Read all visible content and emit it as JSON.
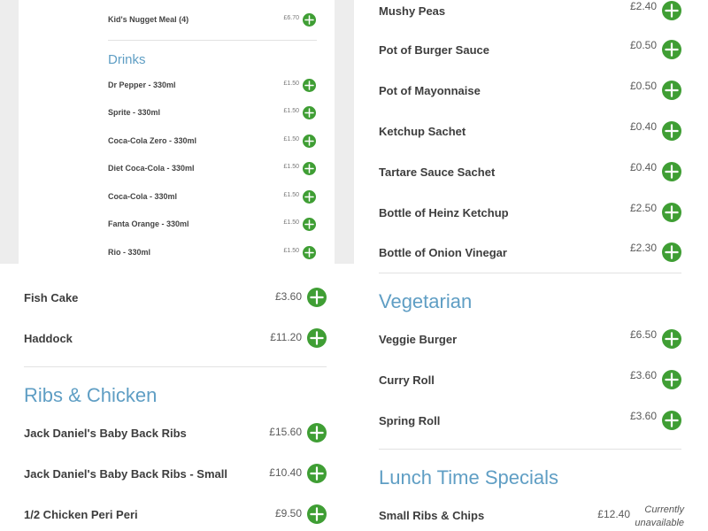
{
  "card": {
    "kids": {
      "name": "Kid's Nugget Meal (4)",
      "price": "£6.70"
    },
    "drinks_heading": "Drinks",
    "drinks": [
      {
        "name": "Dr Pepper - 330ml",
        "price": "£1.50"
      },
      {
        "name": "Sprite - 330ml",
        "price": "£1.50"
      },
      {
        "name": "Coca-Cola Zero - 330ml",
        "price": "£1.50"
      },
      {
        "name": "Diet Coca-Cola - 330ml",
        "price": "£1.50"
      },
      {
        "name": "Coca-Cola - 330ml",
        "price": "£1.50"
      },
      {
        "name": "Fanta Orange - 330ml",
        "price": "£1.50"
      },
      {
        "name": "Rio - 330ml",
        "price": "£1.50"
      }
    ]
  },
  "left": {
    "fish": [
      {
        "name": "Fish Cake",
        "price": "£3.60"
      },
      {
        "name": "Haddock",
        "price": "£11.20"
      }
    ],
    "ribs_heading": "Ribs & Chicken",
    "ribs": [
      {
        "name": "Jack Daniel's Baby Back Ribs",
        "price": "£15.60"
      },
      {
        "name": "Jack Daniel's Baby Back Ribs - Small",
        "price": "£10.40"
      },
      {
        "name": "1/2 Chicken Peri Peri",
        "price": "£9.50"
      }
    ]
  },
  "right": {
    "sides": [
      {
        "name": "Mushy Peas",
        "price": "£2.40"
      },
      {
        "name": "Pot of Burger Sauce",
        "price": "£0.50"
      },
      {
        "name": "Pot of Mayonnaise",
        "price": "£0.50"
      },
      {
        "name": "Ketchup Sachet",
        "price": "£0.40"
      },
      {
        "name": "Tartare Sauce Sachet",
        "price": "£0.40"
      },
      {
        "name": "Bottle of Heinz Ketchup",
        "price": "£2.50"
      },
      {
        "name": "Bottle of Onion Vinegar",
        "price": "£2.30"
      }
    ],
    "veg_heading": "Vegetarian",
    "veg": [
      {
        "name": "Veggie Burger",
        "price": "£6.50"
      },
      {
        "name": "Curry Roll",
        "price": "£3.60"
      },
      {
        "name": "Spring Roll",
        "price": "£3.60"
      }
    ],
    "lunch_heading": "Lunch Time Specials",
    "lunch": [
      {
        "name": "Small Ribs & Chips",
        "price": "£12.40",
        "status": "Currently unavailable"
      }
    ]
  },
  "icons": {
    "add": "plus-icon"
  },
  "colors": {
    "accent": "#3f9e34",
    "heading": "#5f9ec4"
  }
}
